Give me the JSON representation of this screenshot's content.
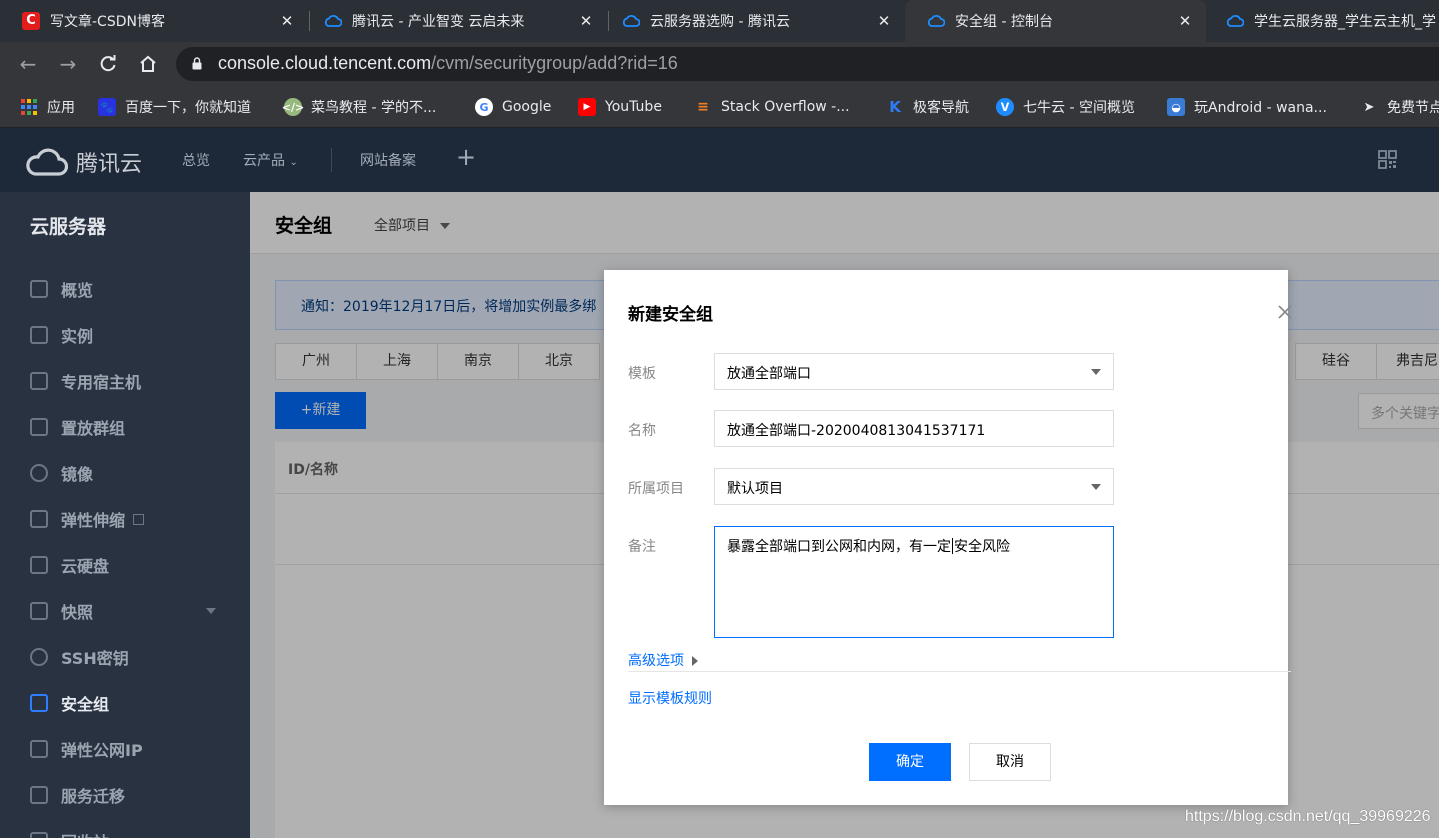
{
  "browser": {
    "tabs": [
      {
        "title": "写文章-CSDN博客",
        "icon": "csdn-icon",
        "active": false
      },
      {
        "title": "腾讯云 - 产业智变 云启未来",
        "icon": "tencent-cloud-icon",
        "active": false
      },
      {
        "title": "云服务器选购 - 腾讯云",
        "icon": "tencent-cloud-icon",
        "active": false
      },
      {
        "title": "安全组 - 控制台",
        "icon": "tencent-cloud-icon",
        "active": true
      },
      {
        "title": "学生云服务器_学生云主机_学",
        "icon": "tencent-cloud-icon",
        "active": false
      }
    ],
    "close_glyph": "✕",
    "url_host": "console.cloud.tencent.com",
    "url_path": "/cvm/securitygroup/add?rid=16",
    "bookmarks": [
      {
        "label": "应用",
        "icon": "apps-grid-icon"
      },
      {
        "label": "百度一下，你就知道",
        "icon": "baidu-icon"
      },
      {
        "label": "菜鸟教程 - 学的不...",
        "icon": "runoob-icon"
      },
      {
        "label": "Google",
        "icon": "google-icon"
      },
      {
        "label": "YouTube",
        "icon": "youtube-icon"
      },
      {
        "label": "Stack Overflow -...",
        "icon": "stackoverflow-icon"
      },
      {
        "label": "极客导航",
        "icon": "jike-icon"
      },
      {
        "label": "七牛云 - 空间概览",
        "icon": "qiniu-icon"
      },
      {
        "label": "玩Android - wana...",
        "icon": "android-icon"
      },
      {
        "label": "免费节点",
        "icon": "paper-plane-icon"
      }
    ]
  },
  "topnav": {
    "brand": "腾讯云",
    "items": [
      "总览",
      "云产品",
      "网站备案"
    ],
    "plus": "+"
  },
  "sidebar": {
    "title": "云服务器",
    "items": [
      {
        "label": "概览",
        "icon": "overview-icon",
        "active": false
      },
      {
        "label": "实例",
        "icon": "instance-icon",
        "active": false
      },
      {
        "label": "专用宿主机",
        "icon": "host-icon",
        "active": false
      },
      {
        "label": "置放群组",
        "icon": "placement-group-icon",
        "active": false
      },
      {
        "label": "镜像",
        "icon": "image-icon",
        "active": false
      },
      {
        "label": "弹性伸缩",
        "icon": "autoscaling-icon",
        "active": false,
        "external": true
      },
      {
        "label": "云硬盘",
        "icon": "disk-icon",
        "active": false
      },
      {
        "label": "快照",
        "icon": "snapshot-icon",
        "active": false,
        "expandable": true
      },
      {
        "label": "SSH密钥",
        "icon": "ssh-key-icon",
        "active": false
      },
      {
        "label": "安全组",
        "icon": "security-group-icon",
        "active": true
      },
      {
        "label": "弹性公网IP",
        "icon": "eip-icon",
        "active": false
      },
      {
        "label": "服务迁移",
        "icon": "migration-icon",
        "active": false
      },
      {
        "label": "回收站",
        "icon": "recycle-icon",
        "active": false
      }
    ]
  },
  "page": {
    "title": "安全组",
    "project_filter": "全部项目",
    "notice": "通知：2019年12月17日后，将增加实例最多绑",
    "regions_left": [
      "广州",
      "上海",
      "南京",
      "北京"
    ],
    "regions_right": [
      "硅谷",
      "弗吉尼"
    ],
    "new_button": "+新建",
    "search_placeholder": "多个关键字",
    "table_header_id": "ID/名称"
  },
  "modal": {
    "title": "新建安全组",
    "template_label": "模板",
    "template_value": "放通全部端口",
    "name_label": "名称",
    "name_value": "放通全部端口-2020040813041537171",
    "project_label": "所属项目",
    "project_value": "默认项目",
    "remark_label": "备注",
    "remark_before_cursor": "暴露全部端口到公网和内网，有一定",
    "remark_after_cursor": "安全风险",
    "advanced_link": "高级选项",
    "show_rules_link": "显示模板规则",
    "confirm_button": "确定",
    "cancel_button": "取消"
  },
  "watermark": "https://blog.csdn.net/qq_39969226"
}
